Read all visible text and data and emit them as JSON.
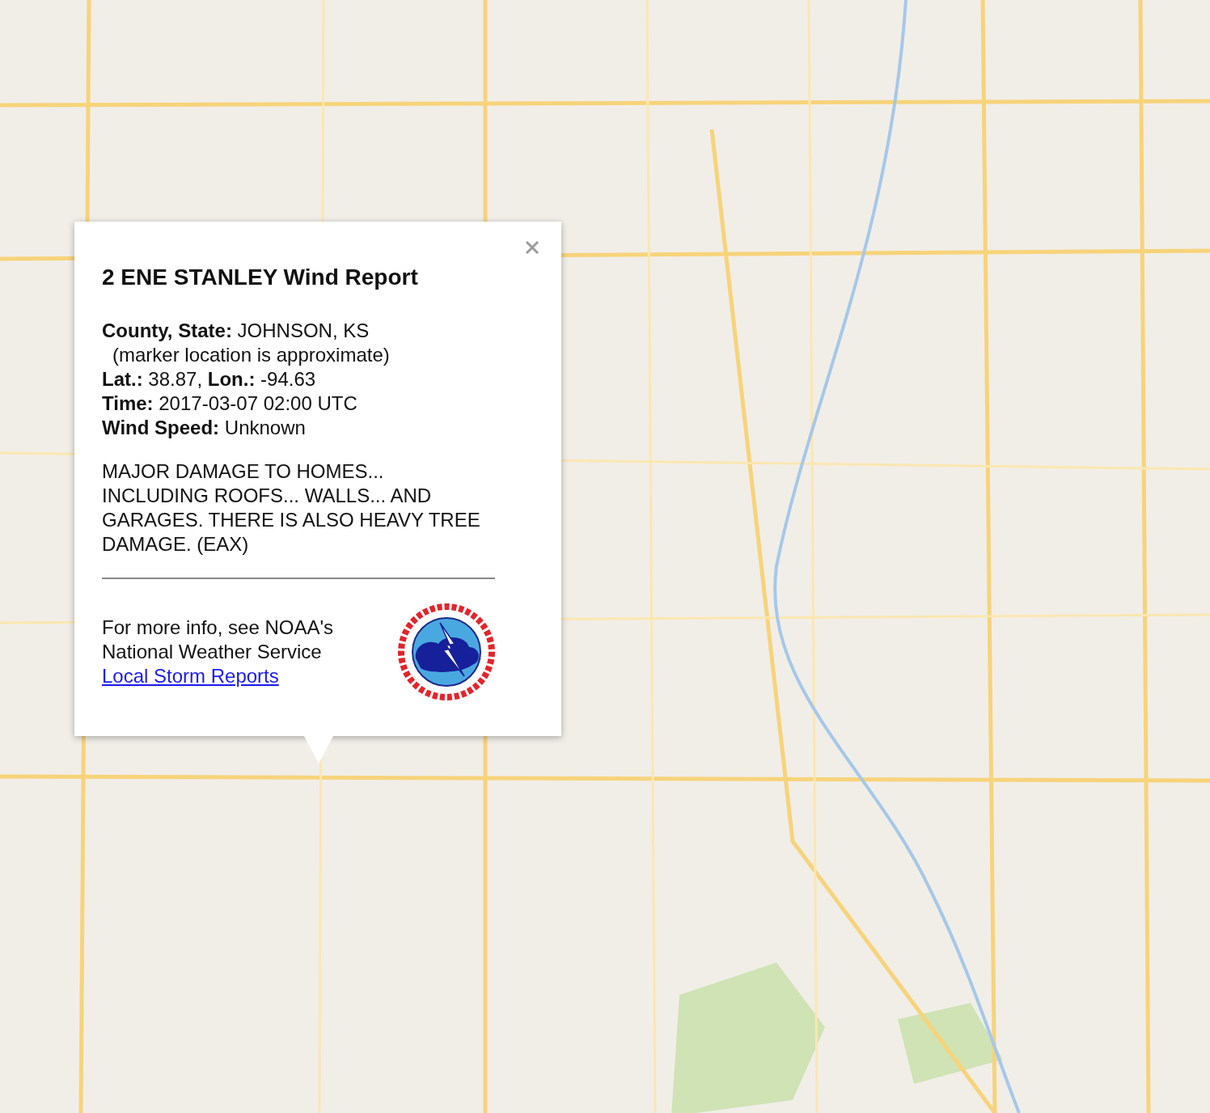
{
  "popup": {
    "title": "2 ENE STANLEY Wind Report",
    "details": [
      {
        "kind": "field",
        "text": "**County, State:** JOHNSON, KS"
      },
      {
        "kind": "note",
        "text": "(marker location is approximate)"
      },
      {
        "kind": "field",
        "text": "**Lat.:** 38.87, **Lon.:** -94.63"
      },
      {
        "kind": "field",
        "text": "**Time:** 2017-03-07 02:00 UTC"
      },
      {
        "kind": "field",
        "text": "**Wind Speed:** Unknown"
      }
    ],
    "remarks": "MAJOR DAMAGE TO HOMES... INCLUDING ROOFS... WALLS... AND GARAGES. THERE IS ALSO HEAVY TREE DAMAGE. (EAX)",
    "more_info": "For more info, see NOAA's National Weather Service",
    "link": "Local Storm Reports"
  }
}
